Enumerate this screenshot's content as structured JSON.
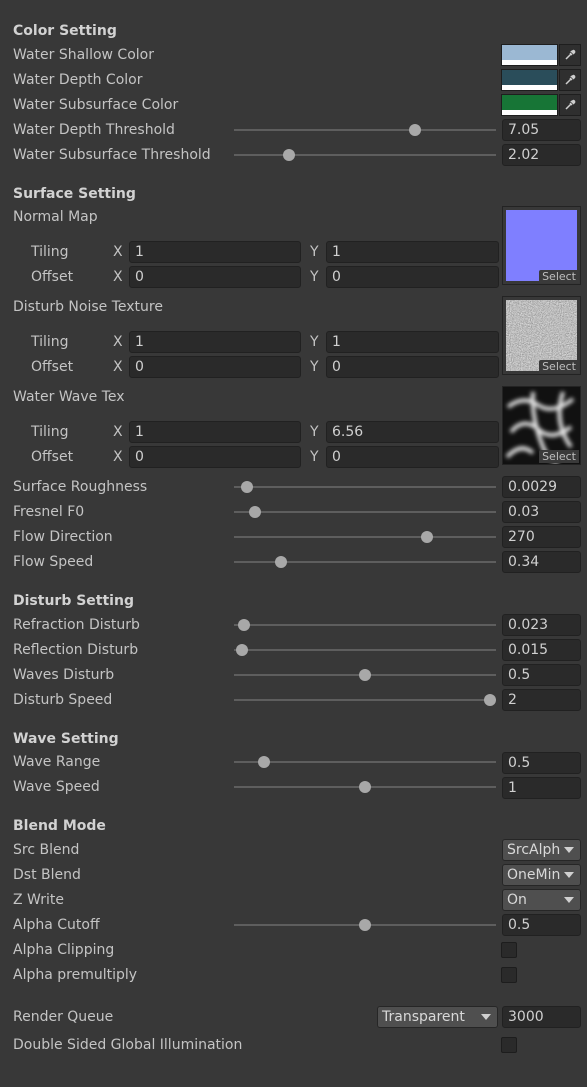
{
  "color_setting": {
    "header": "Color Setting",
    "shallow": {
      "label": "Water Shallow Color",
      "color": "#9bb8d3"
    },
    "depth": {
      "label": "Water Depth Color",
      "color": "#2a4d5a"
    },
    "subsurface": {
      "label": "Water Subsurface Color",
      "color": "#177536"
    },
    "depth_threshold": {
      "label": "Water Depth Threshold",
      "value": "7.05",
      "slider": 0.69
    },
    "subsurface_threshold": {
      "label": "Water Subsurface Threshold",
      "value": "2.02",
      "slider": 0.21
    }
  },
  "surface_setting": {
    "header": "Surface Setting",
    "textures": [
      {
        "label": "Normal Map",
        "tiling_label": "Tiling",
        "offset_label": "Offset",
        "tiling_x": "1",
        "tiling_y": "1",
        "offset_x": "0",
        "offset_y": "0",
        "select_label": "Select",
        "color": "#7f7fff"
      },
      {
        "label": "Disturb Noise Texture",
        "tiling_label": "Tiling",
        "offset_label": "Offset",
        "tiling_x": "1",
        "tiling_y": "1",
        "offset_x": "0",
        "offset_y": "0",
        "select_label": "Select",
        "color": "#8a8a8a"
      },
      {
        "label": "Water Wave Tex",
        "tiling_label": "Tiling",
        "offset_label": "Offset",
        "tiling_x": "1",
        "tiling_y": "6.56",
        "offset_x": "0",
        "offset_y": "0",
        "select_label": "Select",
        "color": "#1a1a1a"
      }
    ],
    "axis_x": "X",
    "axis_y": "Y",
    "sliders": [
      {
        "label": "Surface Roughness",
        "value": "0.0029",
        "slider": 0.05
      },
      {
        "label": "Fresnel F0",
        "value": "0.03",
        "slider": 0.08
      },
      {
        "label": "Flow Direction",
        "value": "270",
        "slider": 0.735
      },
      {
        "label": "Flow Speed",
        "value": "0.34",
        "slider": 0.18
      }
    ]
  },
  "disturb_setting": {
    "header": "Disturb Setting",
    "sliders": [
      {
        "label": "Refraction Disturb",
        "value": "0.023",
        "slider": 0.04
      },
      {
        "label": "Reflection Disturb",
        "value": "0.015",
        "slider": 0.03
      },
      {
        "label": "Waves Disturb",
        "value": "0.5",
        "slider": 0.5
      },
      {
        "label": "Disturb Speed",
        "value": "2",
        "slider": 1.0
      }
    ]
  },
  "wave_setting": {
    "header": "Wave Setting",
    "sliders": [
      {
        "label": "Wave Range",
        "value": "0.5",
        "slider": 0.115
      },
      {
        "label": "Wave Speed",
        "value": "1",
        "slider": 0.5
      }
    ]
  },
  "blend_mode": {
    "header": "Blend Mode",
    "src_blend": {
      "label": "Src Blend",
      "value": "SrcAlph"
    },
    "dst_blend": {
      "label": "Dst Blend",
      "value": "OneMin"
    },
    "z_write": {
      "label": "Z Write",
      "value": "On"
    },
    "alpha_cutoff": {
      "label": "Alpha Cutoff",
      "value": "0.5",
      "slider": 0.5
    },
    "alpha_clipping": {
      "label": "Alpha Clipping",
      "checked": false
    },
    "alpha_premultiply": {
      "label": "Alpha premultiply",
      "checked": false
    }
  },
  "render_queue": {
    "label": "Render Queue",
    "mode": "Transparent",
    "value": "3000"
  },
  "double_sided_gi": {
    "label": "Double Sided Global Illumination",
    "checked": false
  },
  "icons": {
    "picker": "eyedropper-icon",
    "dropdown": "chevron-down-icon"
  }
}
